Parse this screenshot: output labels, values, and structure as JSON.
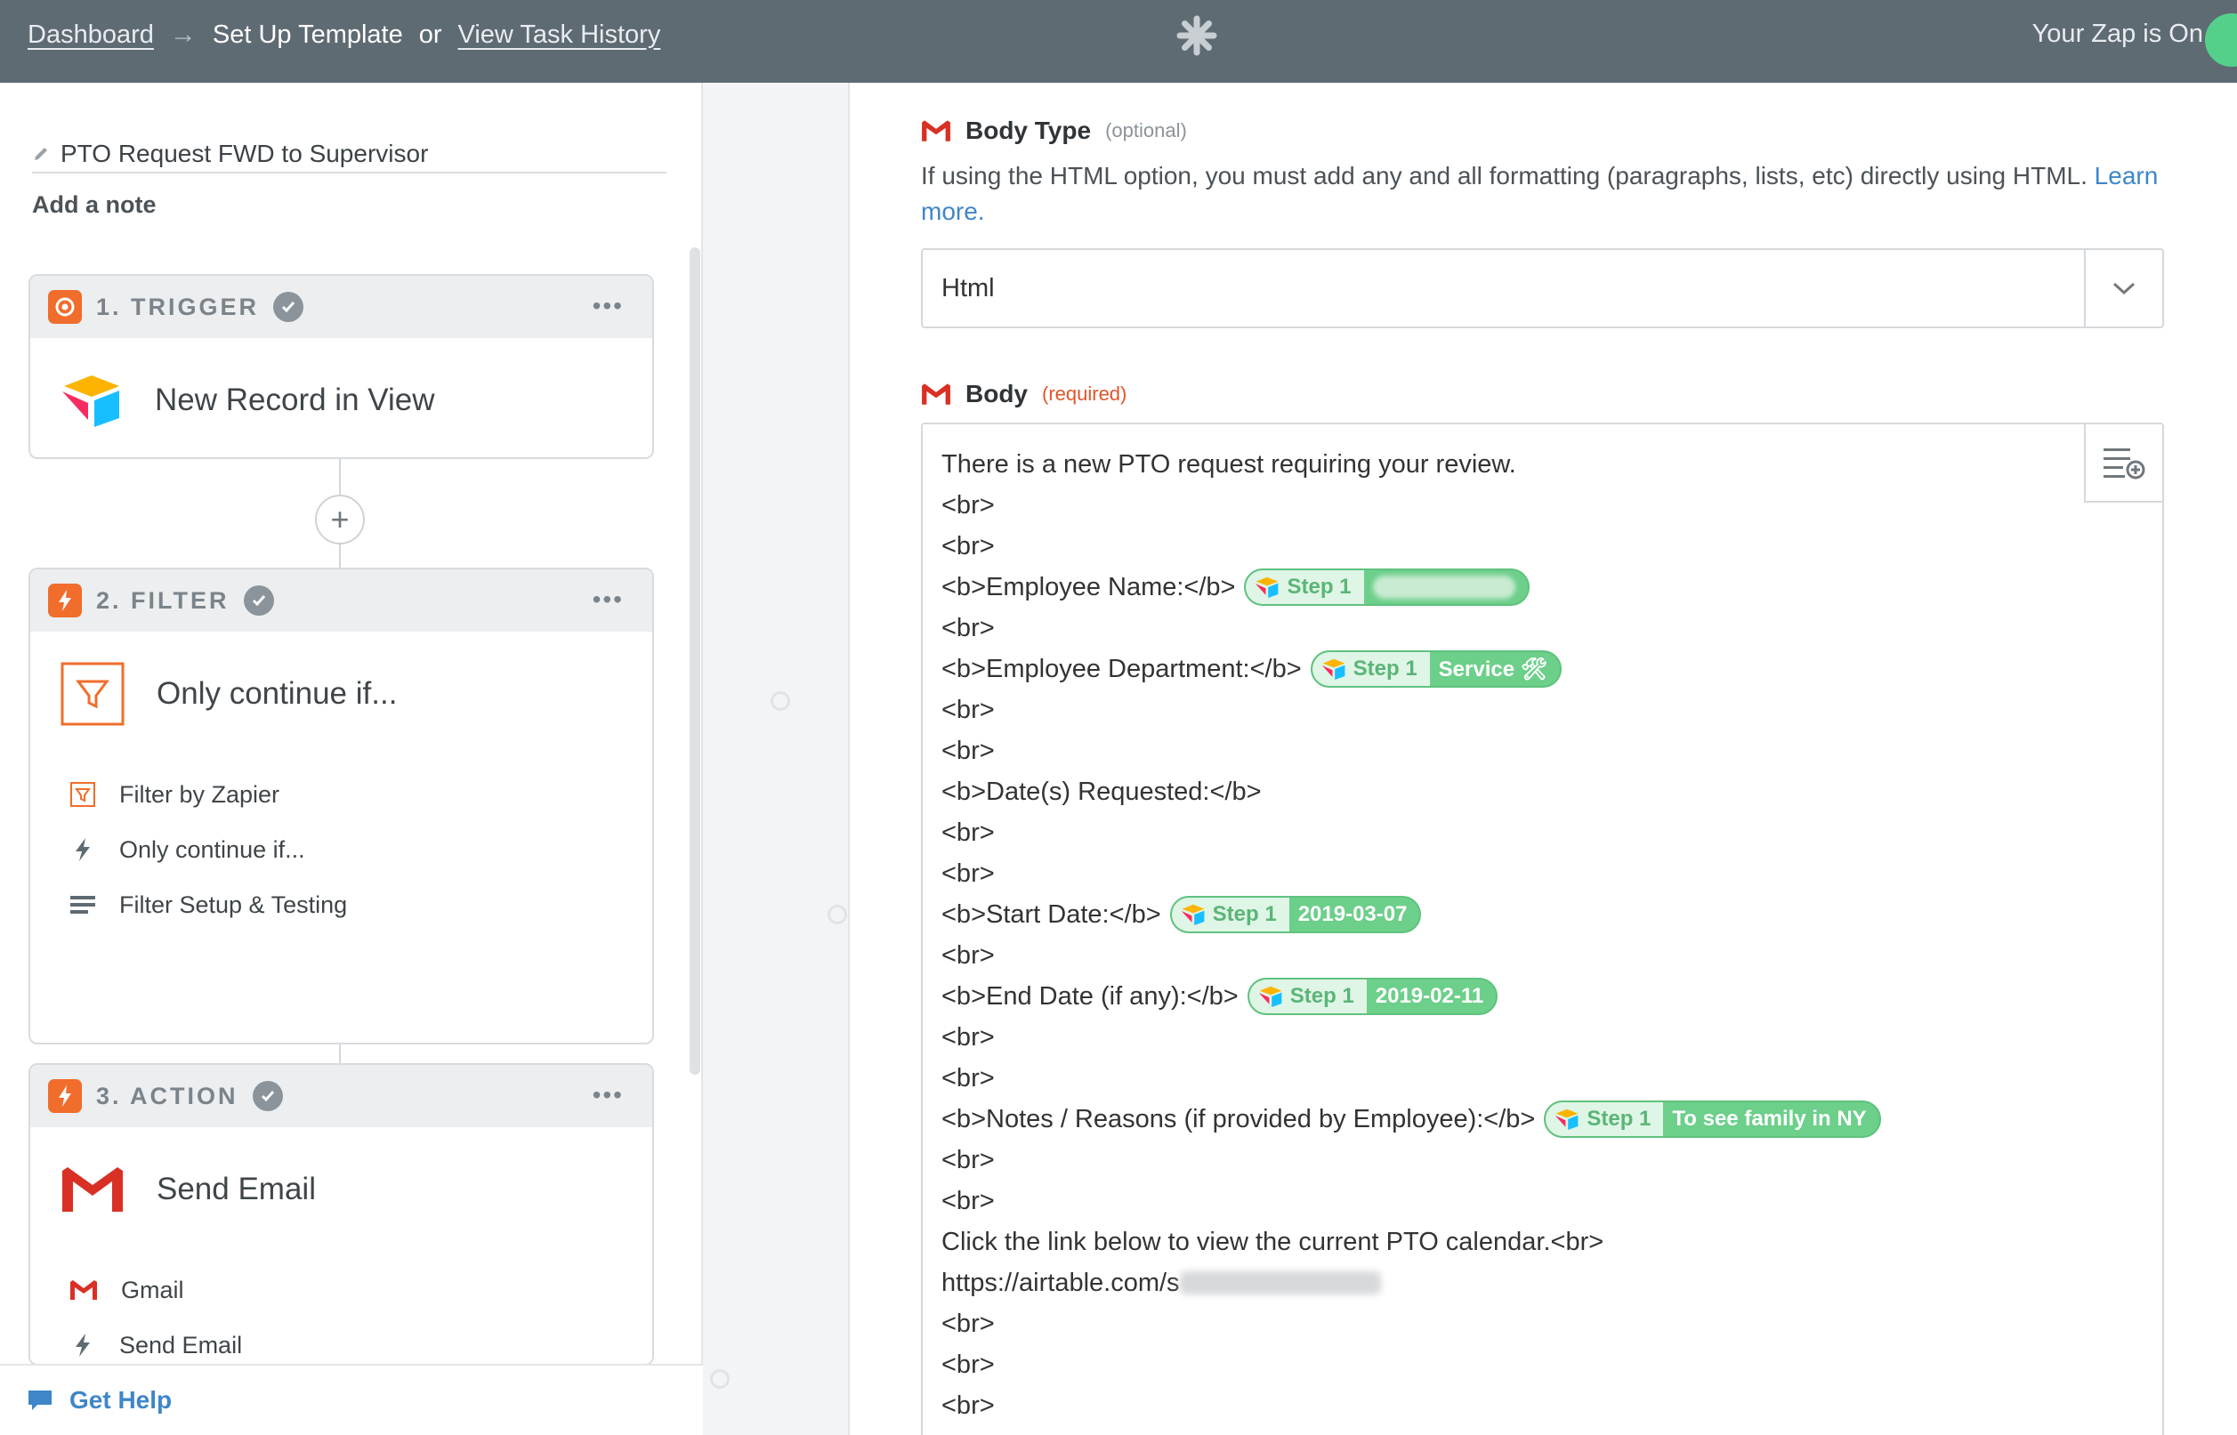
{
  "topbar": {
    "dashboard_link": "Dashboard",
    "arrow": "→",
    "current": "Set Up Template",
    "or": "or",
    "history_link": "View Task History",
    "status": "Your Zap is On"
  },
  "sidebar": {
    "zap_name": "PTO Request FWD to Supervisor",
    "add_note": "Add a note",
    "steps": [
      {
        "label": "1. TRIGGER",
        "title": "New Record in View"
      },
      {
        "label": "2. FILTER",
        "title": "Only continue if...",
        "sub": [
          "Filter by Zapier",
          "Only continue if...",
          "Filter Setup & Testing"
        ]
      },
      {
        "label": "3. ACTION",
        "title": "Send Email",
        "sub": [
          "Gmail",
          "Send Email"
        ]
      }
    ],
    "more": "•••",
    "plus": "+",
    "get_help": "Get Help"
  },
  "form": {
    "body_type_label": "Body Type",
    "optional": "(optional)",
    "help_text": "If using the HTML option, you must add any and all formatting (paragraphs, lists, etc) directly using HTML.",
    "learn_more": "Learn more.",
    "body_type_value": "Html",
    "body_label": "Body",
    "required": "(required)",
    "body_lines": {
      "l1": "There is a new PTO request requiring your review.",
      "br": "<br>",
      "name": "<b>Employee Name:</b>",
      "dept": "<b>Employee Department:</b>",
      "dates": "<b>Date(s) Requested:</b>",
      "start": "<b>Start Date:</b>",
      "end": "<b>End Date (if any):</b>",
      "notes": "<b>Notes / Reasons (if provided by Employee):</b>",
      "link_text": "Click the link below to view the current PTO calendar.<br>",
      "url": "https://airtable.com/s"
    },
    "pills": {
      "step": "Step 1",
      "dept_value": "Service 🛠",
      "start_value": "2019-03-07",
      "end_value": "2019-02-11",
      "notes_value": "To see family in NY"
    }
  },
  "colors": {
    "topbar": "#5f6b73",
    "accent": "#3e86c8",
    "pill": "#6ccf8a",
    "zapier_orange": "#f06d2c",
    "required": "#e3542a"
  }
}
